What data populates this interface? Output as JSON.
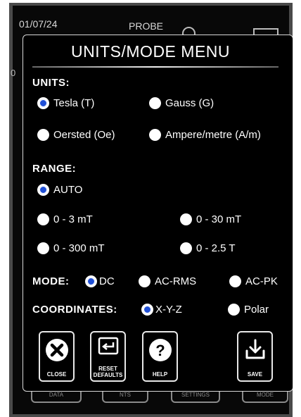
{
  "background": {
    "date": "01/07/24",
    "probe_label": "PROBE",
    "zero_glyph": "0",
    "softkeys": [
      "DATA",
      "NTS",
      "SETTINGS",
      "MODE"
    ]
  },
  "menu": {
    "title": "UNITS/MODE MENU",
    "units": {
      "label": "UNITS:",
      "options": [
        "Tesla (T)",
        "Gauss (G)",
        "Oersted (Oe)",
        "Ampere/metre (A/m)"
      ],
      "selected": "Tesla (T)"
    },
    "range": {
      "label": "RANGE:",
      "options": [
        "AUTO",
        "0 - 3 mT",
        "0 - 30 mT",
        "0 - 300 mT",
        "0 - 2.5 T"
      ],
      "selected": "AUTO"
    },
    "mode": {
      "label": "MODE:",
      "options": [
        "DC",
        "AC-RMS",
        "AC-PK"
      ],
      "selected": "DC"
    },
    "coordinates": {
      "label": "COORDINATES:",
      "options": [
        "X-Y-Z",
        "Polar"
      ],
      "selected": "X-Y-Z"
    },
    "buttons": {
      "close": "CLOSE",
      "reset_line1": "RESET",
      "reset_line2": "DEFAULTS",
      "help": "HELP",
      "save": "SAVE"
    }
  },
  "colors": {
    "selected_radio": "#1f4fd6",
    "panel_background": "#000000",
    "text": "#ffffff"
  }
}
